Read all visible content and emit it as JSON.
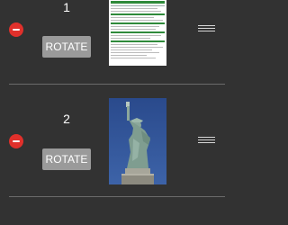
{
  "pages": [
    {
      "number": "1",
      "rotate_label": "ROTATE",
      "thumbnail": "document-page"
    },
    {
      "number": "2",
      "rotate_label": "ROTATE",
      "thumbnail": "statue-of-liberty-photo"
    }
  ],
  "colors": {
    "background": "#323232",
    "delete": "#e0302b",
    "button": "#9a9a9a",
    "divider": "#6a6a6a",
    "sky": "#2d4f8f",
    "statue": "#8ba79b"
  }
}
